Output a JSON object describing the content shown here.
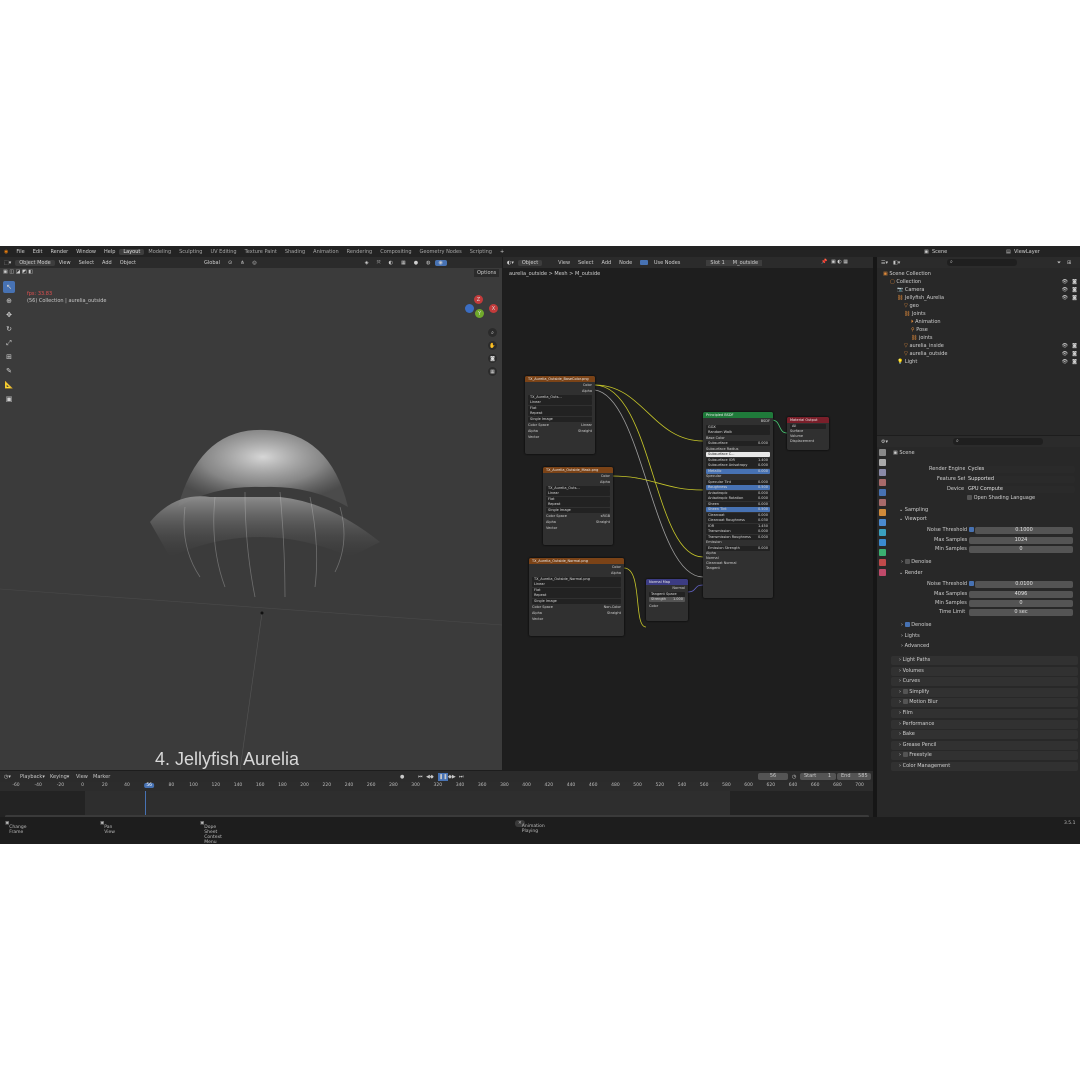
{
  "menubar": {
    "menus": [
      "File",
      "Edit",
      "Render",
      "Window",
      "Help"
    ],
    "workspaces": [
      "Layout",
      "Modeling",
      "Sculpting",
      "UV Editing",
      "Texture Paint",
      "Shading",
      "Animation",
      "Rendering",
      "Compositing",
      "Geometry Nodes",
      "Scripting"
    ],
    "active_workspace": "Layout",
    "scene": "Scene",
    "view_layer": "ViewLayer"
  },
  "viewport": {
    "mode": "Object Mode",
    "menus": [
      "View",
      "Select",
      "Add",
      "Object"
    ],
    "orientation": "Global",
    "options": "Options",
    "fps_line": "fps: 33.83",
    "collection_line": "(56) Collection | aurelia_outside",
    "caption": "4. Jellyfish Aurelia",
    "gizmo": {
      "x": "X",
      "y": "Y",
      "z": "Z"
    }
  },
  "node_editor": {
    "editor_type": "Object",
    "menus": [
      "View",
      "Select",
      "Add",
      "Node"
    ],
    "use_nodes": "Use Nodes",
    "slot": "Slot 1",
    "material": "M_outside",
    "breadcrumb": [
      "aurelia_outside",
      "Mesh",
      "M_outside"
    ],
    "tex1": {
      "title": "TX_Aurelia_Outside_BaseColor.png",
      "outputs": [
        "Color",
        "Alpha"
      ],
      "image": "TX_Aurelia_Outs...",
      "fields": [
        "Linear",
        "Flat",
        "Repeat",
        "Single Image"
      ],
      "color_space_label": "Color Space",
      "color_space": "Linear",
      "alpha_label": "Alpha",
      "alpha": "Straight",
      "vector": "Vector"
    },
    "tex2": {
      "title": "TX_Aurelia_Outside_Mask.png",
      "outputs": [
        "Color",
        "Alpha"
      ],
      "image": "TX_Aurelia_Outs...",
      "fields": [
        "Linear",
        "Flat",
        "Repeat",
        "Single Image"
      ],
      "color_space_label": "Color Space",
      "color_space": "sRGB",
      "alpha_label": "Alpha",
      "alpha": "Straight",
      "vector": "Vector"
    },
    "tex3": {
      "title": "TX_Aurelia_Outside_Normal.png",
      "outputs": [
        "Color",
        "Alpha"
      ],
      "image": "TX_Aurelia_Outside_Normal.png",
      "fields": [
        "Linear",
        "Flat",
        "Repeat",
        "Single Image"
      ],
      "color_space_label": "Color Space",
      "color_space": "Non-Color",
      "alpha_label": "Alpha",
      "alpha": "Straight",
      "vector": "Vector"
    },
    "normal_map": {
      "title": "Normal Map",
      "output": "Normal",
      "space": "Tangent Space",
      "strength_label": "Strength",
      "strength": "1.000",
      "color": "Color"
    },
    "bsdf": {
      "title": "Principled BSDF",
      "output": "BSDF",
      "distribution": "GGX",
      "subsurface_method": "Random Walk",
      "rows": [
        {
          "label": "Base Color",
          "value": ""
        },
        {
          "label": "Subsurface",
          "value": "0.000"
        },
        {
          "label": "Subsurface Radius",
          "value": ""
        },
        {
          "label": "Subsurface C...",
          "value": ""
        },
        {
          "label": "Subsurface IOR",
          "value": "1.400"
        },
        {
          "label": "Subsurface Anisotropy",
          "value": "0.000"
        },
        {
          "label": "Metallic",
          "value": "0.000"
        },
        {
          "label": "Specular",
          "value": ""
        },
        {
          "label": "Specular Tint",
          "value": "0.000"
        },
        {
          "label": "Roughness",
          "value": "0.500"
        },
        {
          "label": "Anisotropic",
          "value": "0.000"
        },
        {
          "label": "Anisotropic Rotation",
          "value": "0.000"
        },
        {
          "label": "Sheen",
          "value": "0.000"
        },
        {
          "label": "Sheen Tint",
          "value": "0.500"
        },
        {
          "label": "Clearcoat",
          "value": "0.000"
        },
        {
          "label": "Clearcoat Roughness",
          "value": "0.030"
        },
        {
          "label": "IOR",
          "value": "1.450"
        },
        {
          "label": "Transmission",
          "value": "0.000"
        },
        {
          "label": "Transmission Roughness",
          "value": "0.000"
        },
        {
          "label": "Emission",
          "value": ""
        },
        {
          "label": "Emission Strength",
          "value": "0.000"
        },
        {
          "label": "Alpha",
          "value": ""
        },
        {
          "label": "Normal",
          "value": ""
        },
        {
          "label": "Clearcoat Normal",
          "value": ""
        },
        {
          "label": "Tangent",
          "value": ""
        }
      ]
    },
    "output_node": {
      "title": "Material Output",
      "target": "All",
      "inputs": [
        "Surface",
        "Volume",
        "Displacement"
      ]
    }
  },
  "outliner": {
    "rows": [
      {
        "label": "Scene Collection",
        "indent": 0
      },
      {
        "label": "Collection",
        "indent": 1
      },
      {
        "label": "Camera",
        "indent": 2
      },
      {
        "label": "Jellyfish_Aurelia",
        "indent": 2
      },
      {
        "label": "geo",
        "indent": 3
      },
      {
        "label": "Joints",
        "indent": 3
      },
      {
        "label": "Animation",
        "indent": 4
      },
      {
        "label": "Pose",
        "indent": 4
      },
      {
        "label": "joints",
        "indent": 4
      },
      {
        "label": "aurelia_inside",
        "indent": 3
      },
      {
        "label": "aurelia_outside",
        "indent": 3
      },
      {
        "label": "Light",
        "indent": 2
      }
    ]
  },
  "properties": {
    "context": "Scene",
    "render_engine_label": "Render Engine",
    "render_engine": "Cycles",
    "feature_set_label": "Feature Set",
    "feature_set": "Supported",
    "device_label": "Device",
    "device": "GPU Compute",
    "osl": "Open Shading Language",
    "sampling": "Sampling",
    "viewport": "Viewport",
    "vp_noise_label": "Noise Threshold",
    "vp_noise": "0.1000",
    "vp_max_label": "Max Samples",
    "vp_max": "1024",
    "vp_min_label": "Min Samples",
    "vp_min": "0",
    "denoise": "Denoise",
    "render": "Render",
    "r_noise_label": "Noise Threshold",
    "r_noise": "0.0100",
    "r_max_label": "Max Samples",
    "r_max": "4096",
    "r_min_label": "Min Samples",
    "r_min": "0",
    "time_limit_label": "Time Limit",
    "time_limit": "0 sec",
    "denoise2": "Denoise",
    "lights": "Lights",
    "advanced": "Advanced",
    "panels": [
      "Light Paths",
      "Volumes",
      "Curves",
      "Simplify",
      "Motion Blur",
      "Film",
      "Performance",
      "Bake",
      "Grease Pencil",
      "Freestyle",
      "Color Management"
    ]
  },
  "timeline": {
    "menus": [
      "Playback",
      "Keying",
      "View",
      "Marker"
    ],
    "current_frame": "56",
    "start_label": "Start",
    "start": "1",
    "end_label": "End",
    "end": "585",
    "ticks": [
      "-60",
      "-40",
      "-20",
      "0",
      "20",
      "40",
      "56",
      "80",
      "100",
      "120",
      "140",
      "160",
      "180",
      "200",
      "220",
      "240",
      "260",
      "280",
      "300",
      "320",
      "340",
      "360",
      "380",
      "400",
      "420",
      "440",
      "460",
      "480",
      "500",
      "520",
      "540",
      "560",
      "580",
      "600",
      "620",
      "640",
      "660",
      "680",
      "700"
    ]
  },
  "statusbar": {
    "left1": "Change Frame",
    "left2": "Pan View",
    "left3": "Dope Sheet Context Menu",
    "center": "Animation Playing",
    "version": "3.5.1"
  }
}
